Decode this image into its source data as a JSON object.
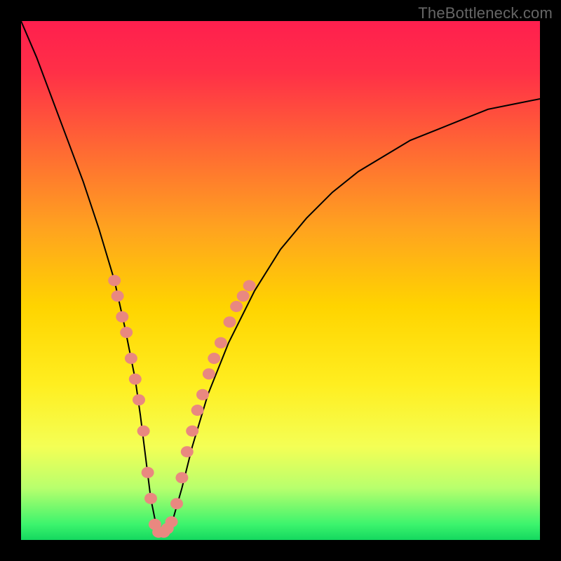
{
  "watermark": "TheBottleneck.com",
  "colors": {
    "bg_border": "#000000",
    "curve": "#000000",
    "marker": "#e98880",
    "gradient_stops": [
      {
        "offset": 0.0,
        "color": "#ff1f4e"
      },
      {
        "offset": 0.1,
        "color": "#ff3047"
      },
      {
        "offset": 0.25,
        "color": "#ff6a33"
      },
      {
        "offset": 0.4,
        "color": "#ffa31f"
      },
      {
        "offset": 0.55,
        "color": "#ffd400"
      },
      {
        "offset": 0.7,
        "color": "#ffee20"
      },
      {
        "offset": 0.82,
        "color": "#f4ff55"
      },
      {
        "offset": 0.9,
        "color": "#b8ff6d"
      },
      {
        "offset": 0.97,
        "color": "#3cf46d"
      },
      {
        "offset": 1.0,
        "color": "#14d85f"
      }
    ]
  },
  "chart_data": {
    "type": "line",
    "title": "",
    "xlabel": "",
    "ylabel": "",
    "xlim": [
      0,
      100
    ],
    "ylim": [
      0,
      100
    ],
    "series": [
      {
        "name": "bottleneck-curve",
        "x": [
          0,
          3,
          6,
          9,
          12,
          15,
          18,
          20,
          22,
          23,
          24,
          25,
          26,
          27,
          28,
          29,
          31,
          33,
          36,
          40,
          45,
          50,
          55,
          60,
          65,
          70,
          75,
          80,
          85,
          90,
          95,
          100
        ],
        "y": [
          100,
          93,
          85,
          77,
          69,
          60,
          50,
          41,
          31,
          24,
          16,
          8,
          3,
          1,
          1,
          3,
          10,
          18,
          28,
          38,
          48,
          56,
          62,
          67,
          71,
          74,
          77,
          79,
          81,
          83,
          84,
          85
        ]
      }
    ],
    "markers": [
      {
        "x": 18.0,
        "y": 50
      },
      {
        "x": 18.6,
        "y": 47
      },
      {
        "x": 19.5,
        "y": 43
      },
      {
        "x": 20.3,
        "y": 40
      },
      {
        "x": 21.2,
        "y": 35
      },
      {
        "x": 22.0,
        "y": 31
      },
      {
        "x": 22.7,
        "y": 27
      },
      {
        "x": 23.6,
        "y": 21
      },
      {
        "x": 24.4,
        "y": 13
      },
      {
        "x": 25.0,
        "y": 8
      },
      {
        "x": 25.8,
        "y": 3
      },
      {
        "x": 26.5,
        "y": 1.5
      },
      {
        "x": 27.5,
        "y": 1.5
      },
      {
        "x": 28.2,
        "y": 2.2
      },
      {
        "x": 29.0,
        "y": 3.5
      },
      {
        "x": 30.0,
        "y": 7
      },
      {
        "x": 31.0,
        "y": 12
      },
      {
        "x": 32.0,
        "y": 17
      },
      {
        "x": 33.0,
        "y": 21
      },
      {
        "x": 34.0,
        "y": 25
      },
      {
        "x": 35.0,
        "y": 28
      },
      {
        "x": 36.2,
        "y": 32
      },
      {
        "x": 37.2,
        "y": 35
      },
      {
        "x": 38.5,
        "y": 38
      },
      {
        "x": 40.2,
        "y": 42
      },
      {
        "x": 41.5,
        "y": 45
      },
      {
        "x": 42.8,
        "y": 47
      },
      {
        "x": 44.0,
        "y": 49
      }
    ]
  }
}
